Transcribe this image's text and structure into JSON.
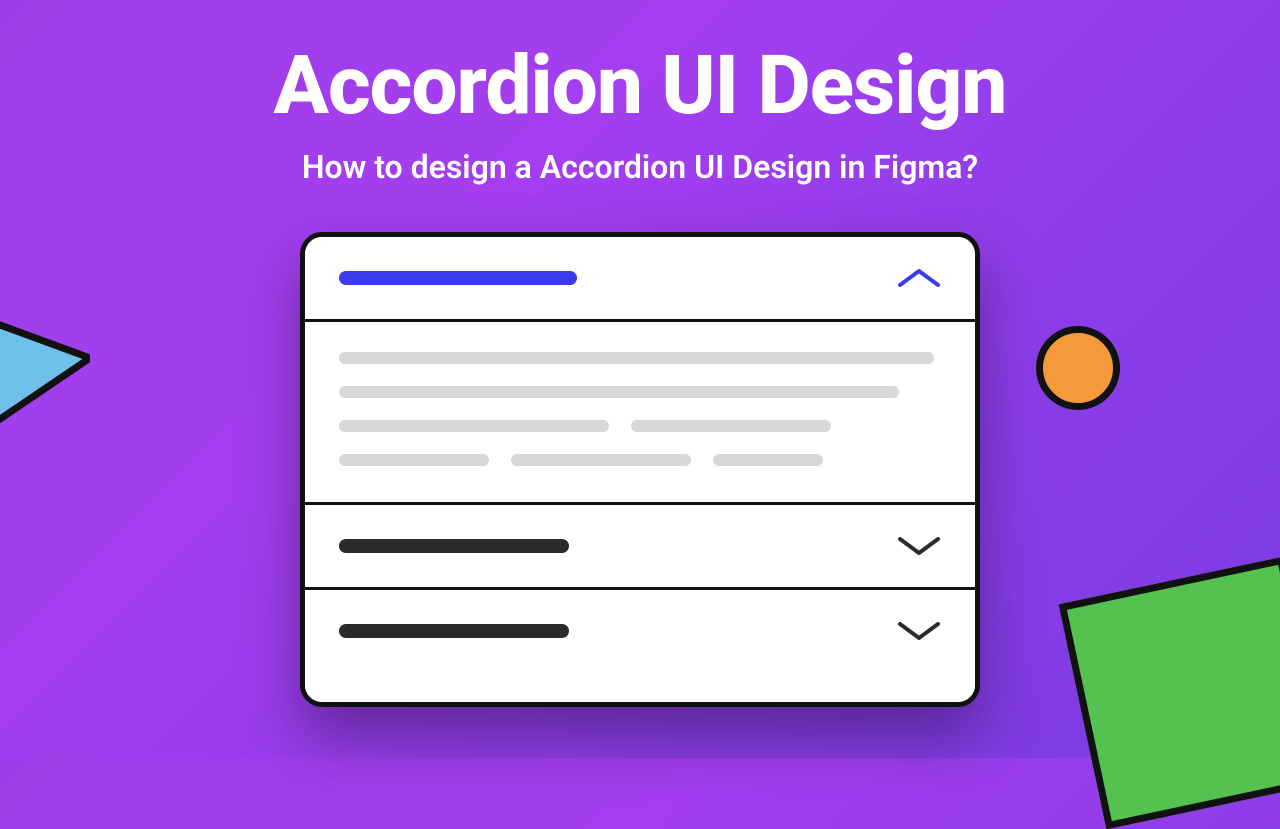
{
  "title": "Accordion UI Design",
  "subtitle": "How to design a Accordion UI Design in Figma?",
  "colors": {
    "accent_blue": "#3d3bee",
    "accent_orange": "#f39a3b",
    "accent_green": "#54c24f",
    "accent_lightblue": "#6ec0e8",
    "text_dark": "#2b2b2b",
    "placeholder": "#d8d8d8",
    "border": "#111111"
  },
  "accordion": {
    "items": [
      {
        "state": "expanded",
        "title_color": "blue",
        "chevron": "up"
      },
      {
        "state": "collapsed",
        "title_color": "dark",
        "chevron": "down"
      },
      {
        "state": "collapsed",
        "title_color": "dark",
        "chevron": "down"
      }
    ]
  }
}
